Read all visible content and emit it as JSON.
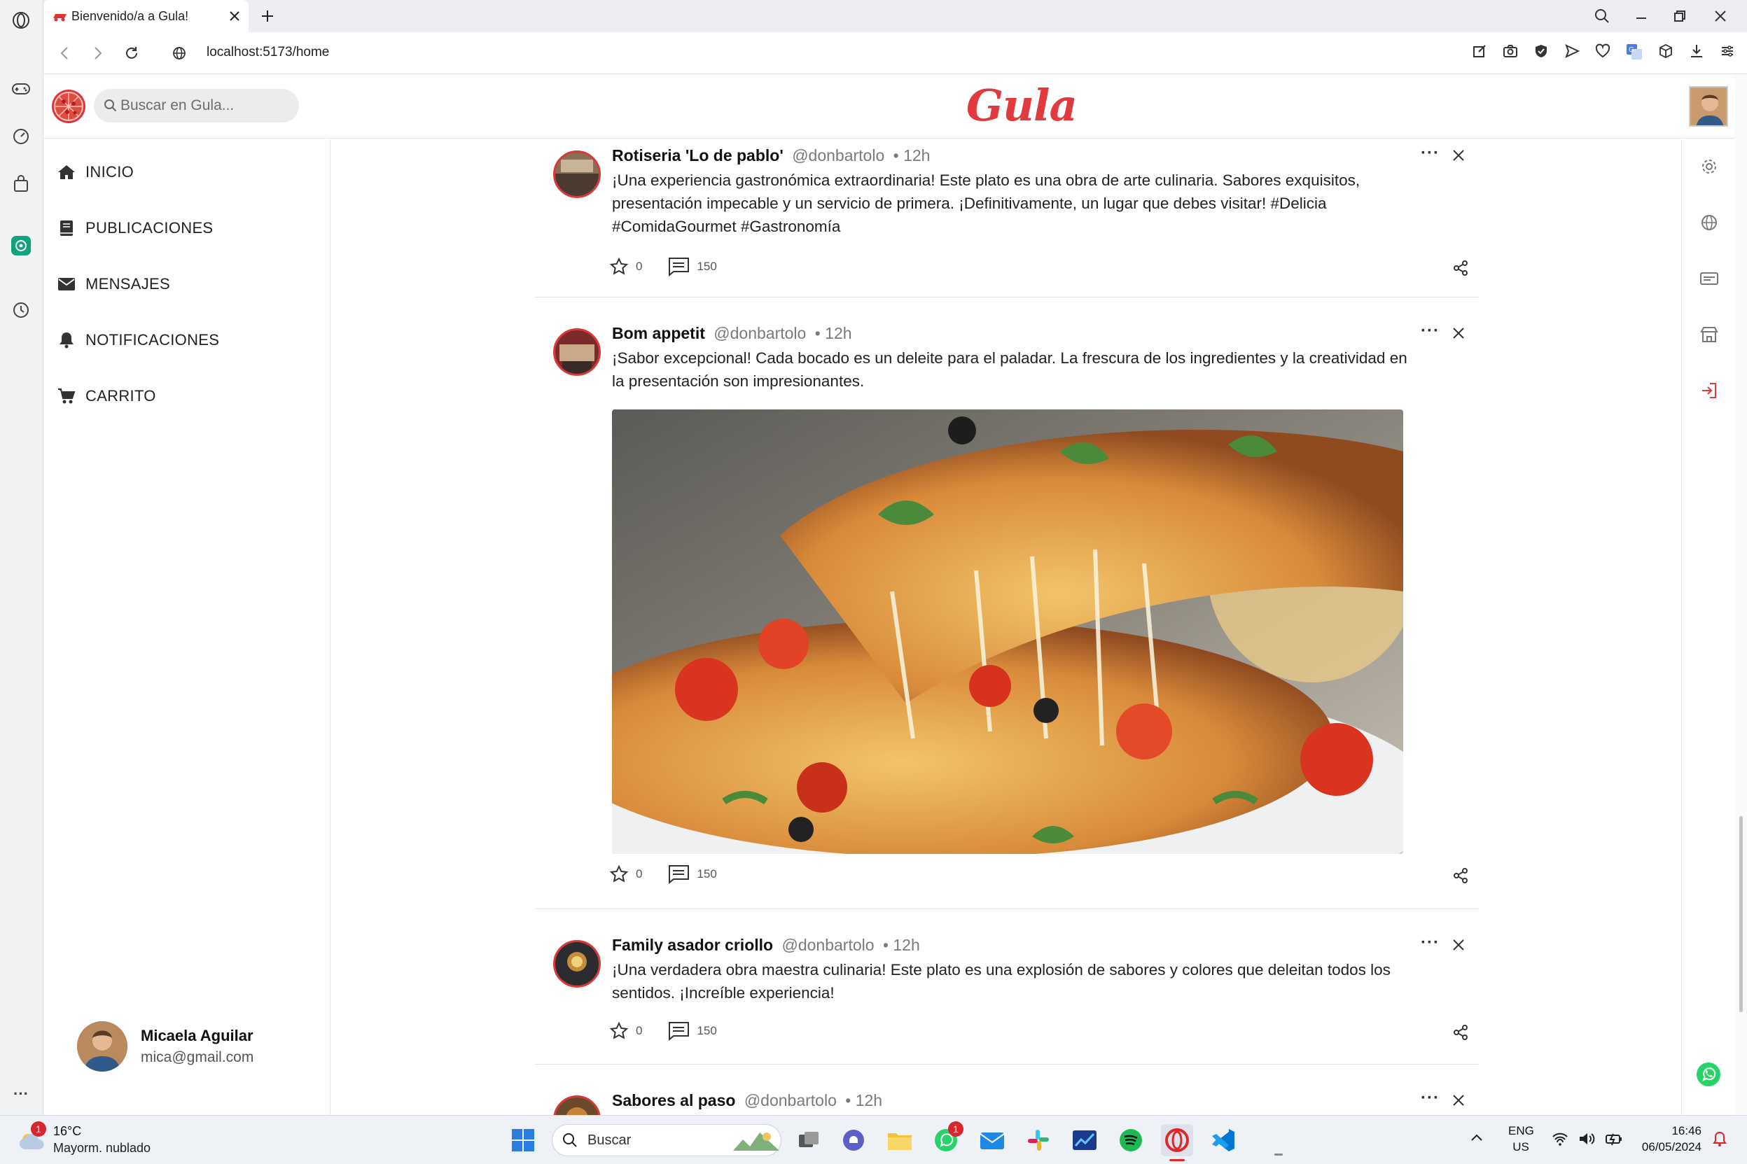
{
  "browser": {
    "tab_title": "Bienvenido/a a Gula!",
    "url": "localhost:5173/home"
  },
  "app": {
    "logo_text": "Gula",
    "search_placeholder": "Buscar en Gula...",
    "brand_color": "#e0393e"
  },
  "nav": {
    "items": [
      {
        "label": "INICIO",
        "icon": "home-icon"
      },
      {
        "label": "PUBLICACIONES",
        "icon": "book-icon"
      },
      {
        "label": "MENSAJES",
        "icon": "envelope-icon"
      },
      {
        "label": "NOTIFICACIONES",
        "icon": "bell-icon"
      },
      {
        "label": "CARRITO",
        "icon": "cart-icon"
      }
    ]
  },
  "user": {
    "name": "Micaela Aguilar",
    "email": "mica@gmail.com"
  },
  "posts": [
    {
      "name": "Rotiseria 'Lo de pablo'",
      "handle": "@donbartolo",
      "time": "• 12h",
      "text": "¡Una experiencia gastronómica extraordinaria! Este plato es una obra de arte culinaria. Sabores exquisitos, presentación impecable y un servicio de primera. ¡Definitivamente, un lugar que debes visitar! #Delicia #ComidaGourmet #Gastronomía",
      "stars": "0",
      "comments": "150"
    },
    {
      "name": "Bom appetit",
      "handle": "@donbartolo",
      "time": "• 12h",
      "text": "¡Sabor excepcional! Cada bocado es un deleite para el paladar. La frescura de los ingredientes y la creatividad en la presentación son impresionantes.",
      "stars": "0",
      "comments": "150"
    },
    {
      "name": "Family asador criollo",
      "handle": "@donbartolo",
      "time": "• 12h",
      "text": "¡Una verdadera obra maestra culinaria! Este plato es una explosión de sabores y colores que deleitan todos los sentidos. ¡Increíble experiencia!",
      "stars": "0",
      "comments": "150"
    },
    {
      "name": "Sabores al paso",
      "handle": "@donbartolo",
      "time": "• 12h"
    }
  ],
  "taskbar": {
    "weather_temp": "16°C",
    "weather_desc": "Mayorm. nublado",
    "weather_badge": "1",
    "search_label": "Buscar",
    "whatsapp_badge": "1",
    "lang": "ENG",
    "region": "US",
    "time": "16:46",
    "date": "06/05/2024"
  }
}
